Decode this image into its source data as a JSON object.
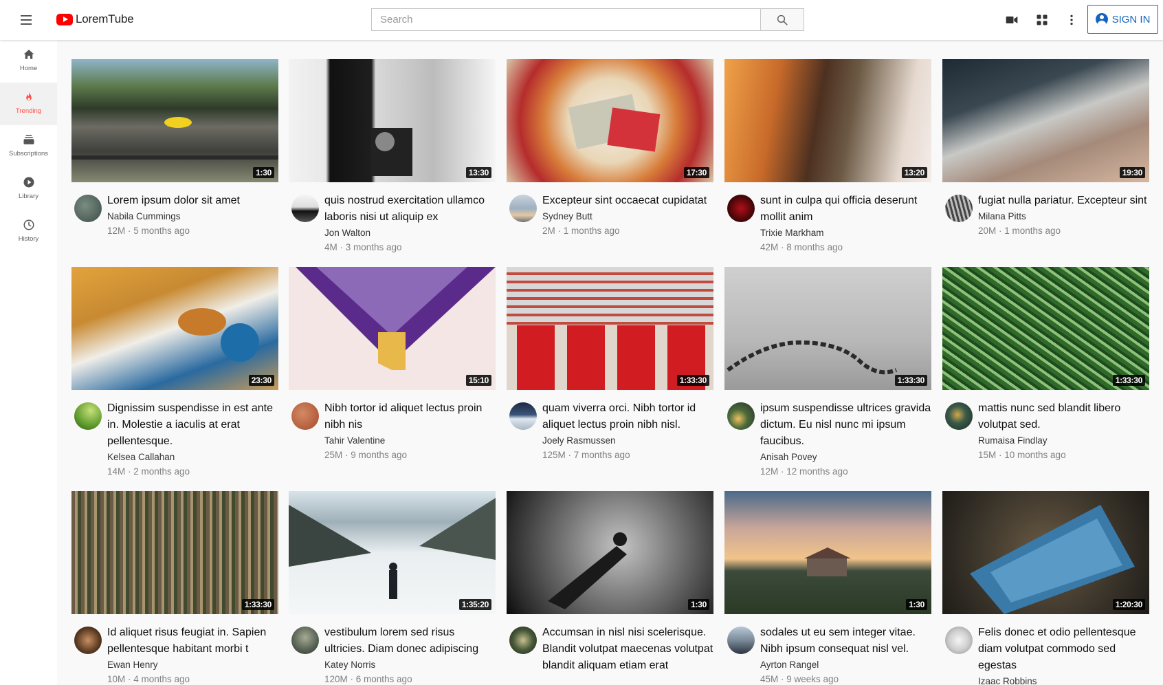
{
  "app": {
    "name": "LoremTube",
    "brand_color": "#ff0000",
    "accent_color": "#1565c0"
  },
  "header": {
    "menu_icon": "hamburger-menu-icon",
    "search_placeholder": "Search",
    "search_icon": "search-icon",
    "create_icon": "video-camera-icon",
    "apps_icon": "apps-grid-icon",
    "more_icon": "more-vert-icon",
    "sign_in_label": "SIGN IN"
  },
  "sidebar": {
    "items": [
      {
        "label": "Home",
        "icon": "home-icon",
        "active": false
      },
      {
        "label": "Trending",
        "icon": "fire-icon",
        "active": true
      },
      {
        "label": "Subscriptions",
        "icon": "subscriptions-icon",
        "active": false
      },
      {
        "label": "Library",
        "icon": "library-play-icon",
        "active": false
      },
      {
        "label": "History",
        "icon": "history-clock-icon",
        "active": false
      }
    ]
  },
  "videos": [
    {
      "title": "Lorem ipsum dolor sit amet",
      "channel": "Nabila Cummings",
      "stats": "12M · 5 months ago",
      "duration": "1:30"
    },
    {
      "title": "quis nostrud exercitation ullamco laboris nisi ut aliquip ex",
      "channel": "Jon Walton",
      "stats": "4M · 3 months ago",
      "duration": "13:30"
    },
    {
      "title": "Excepteur sint occaecat cupidatat",
      "channel": "Sydney Butt",
      "stats": "2M · 1 months ago",
      "duration": "17:30"
    },
    {
      "title": "sunt in culpa qui officia deserunt mollit anim",
      "channel": "Trixie Markham",
      "stats": "42M · 8 months ago",
      "duration": "13:20"
    },
    {
      "title": "fugiat nulla pariatur. Excepteur sint",
      "channel": "Milana Pitts",
      "stats": "20M · 1 months ago",
      "duration": "19:30"
    },
    {
      "title": "Dignissim suspendisse in est ante in. Molestie a iaculis at erat pellentesque.",
      "channel": "Kelsea Callahan",
      "stats": "14M · 2 months ago",
      "duration": "23:30"
    },
    {
      "title": "Nibh tortor id aliquet lectus proin nibh nis",
      "channel": "Tahir Valentine",
      "stats": "25M · 9 months ago",
      "duration": "15:10"
    },
    {
      "title": "quam viverra orci. Nibh tortor id aliquet lectus proin nibh nisl.",
      "channel": "Joely Rasmussen",
      "stats": "125M · 7 months ago",
      "duration": "1:33:30"
    },
    {
      "title": "ipsum suspendisse ultrices gravida dictum. Eu nisl nunc mi ipsum faucibus.",
      "channel": "Anisah Povey",
      "stats": "12M · 12 months ago",
      "duration": "1:33:30"
    },
    {
      "title": "mattis nunc sed blandit libero volutpat sed.",
      "channel": "Rumaisa Findlay",
      "stats": "15M · 10 months ago",
      "duration": "1:33:30"
    },
    {
      "title": "Id aliquet risus feugiat in. Sapien pellentesque habitant morbi t",
      "channel": "Ewan Henry",
      "stats": "10M · 4 months ago",
      "duration": "1:33:30"
    },
    {
      "title": "vestibulum lorem sed risus ultricies. Diam donec adipiscing",
      "channel": "Katey Norris",
      "stats": "120M · 6 months ago",
      "duration": "1:35:20"
    },
    {
      "title": "Accumsan in nisl nisi scelerisque. Blandit volutpat maecenas volutpat blandit aliquam etiam erat",
      "channel": "",
      "stats": "",
      "duration": "1:30"
    },
    {
      "title": "sodales ut eu sem integer vitae. Nibh ipsum consequat nisl vel.",
      "channel": "Ayrton Rangel",
      "stats": "45M · 9 weeks ago",
      "duration": "1:30"
    },
    {
      "title": "Felis donec et odio pellentesque diam volutpat commodo sed egestas",
      "channel": "Izaac Robbins",
      "stats": "",
      "duration": "1:20:30"
    }
  ]
}
